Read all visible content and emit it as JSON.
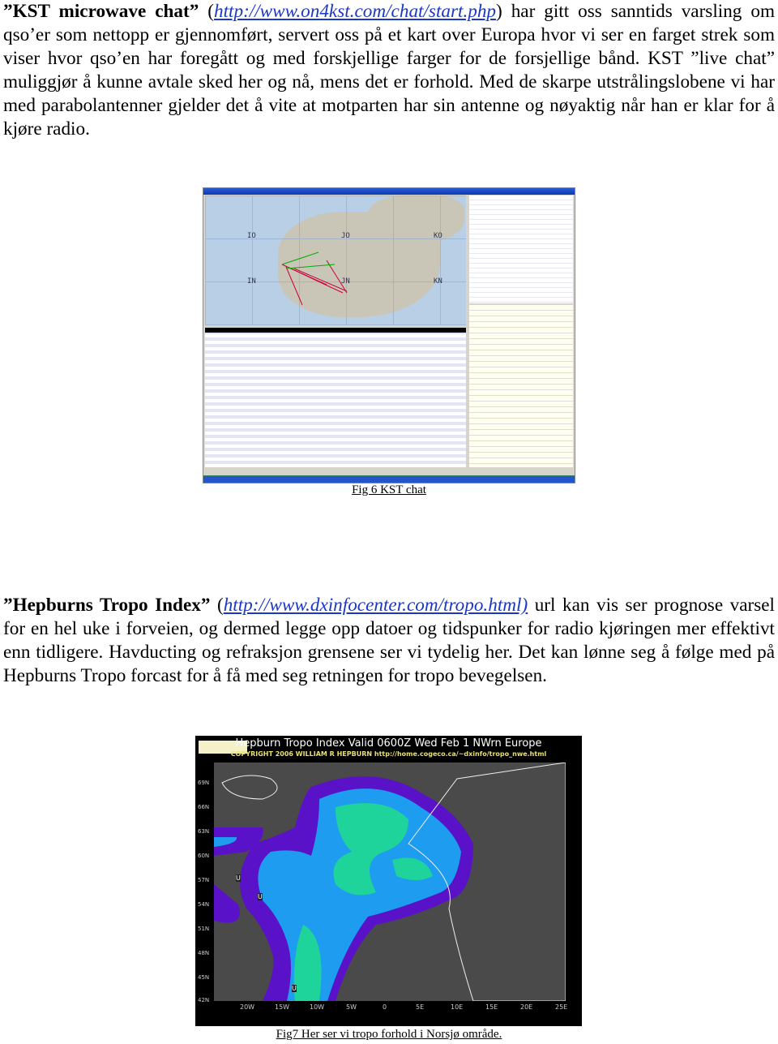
{
  "para1": {
    "title": "”KST microwave chat”",
    "open": "(",
    "link": "http://www.on4kst.com/chat/start.php",
    "close": ")",
    "text": " har gitt oss sanntids varsling om qso’er som nettopp er gjennomført, servert oss på et kart over Europa  hvor vi ser en farget strek som viser hvor qso’en har foregått og med forskjellige farger for de forsjellige bånd. KST ”live chat” muliggjør å kunne avtale sked her og nå, mens det er forhold. Med de skarpe utstrålingslobene vi har med parabolantenner gjelder det å vite at motparten har sin antenne og nøyaktig når han er klar for å kjøre radio."
  },
  "fig6": {
    "caption": "Fig 6 KST chat",
    "locators": [
      "IO",
      "JO",
      "KO",
      "IN",
      "JN",
      "KN"
    ]
  },
  "para2": {
    "title": "”Hepburns Tropo Index”",
    "open": "(",
    "link": "http://www.dxinfocenter.com/tropo.html)",
    "text": " url kan vis ser prognose varsel for en hel uke i forveien, og dermed legge opp datoer og tidspunker for radio kjøringen mer effektivt enn tidligere. Havducting og refraksjon grensene ser vi tydelig her. Det kan lønne seg å følge med på Hepburns Tropo forcast for å få med seg retningen for tropo bevegelsen."
  },
  "fig7": {
    "title": "Hepburn Tropo Index Valid 0600Z Wed Feb 1 NWrn Europe",
    "subtitle": "COPYRIGHT 2006   WILLIAM R HEPBURN   http://home.cogeco.ca/~dxinfo/tropo_nwe.html",
    "lat_labels": [
      "69N",
      "66N",
      "63N",
      "60N",
      "57N",
      "54N",
      "51N",
      "48N",
      "45N",
      "42N"
    ],
    "lon_labels": [
      "20W",
      "15W",
      "10W",
      "5W",
      "0",
      "5E",
      "10E",
      "15E",
      "20E",
      "25E"
    ],
    "marker": "U",
    "colors": {
      "background": "#4a4a4a",
      "level1": "#5a12c8",
      "level2": "#1e9cf0",
      "level3": "#1ed49a"
    },
    "caption": "Fig7 Her ser vi tropo forhold i Norsjø område."
  }
}
